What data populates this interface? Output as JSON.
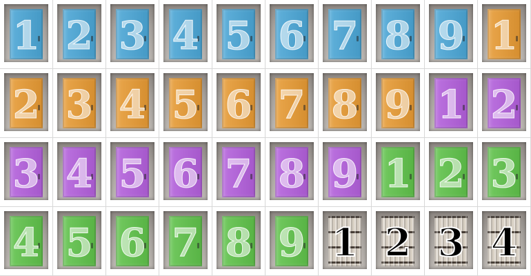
{
  "doors": [
    {
      "number": "1",
      "color": "#4aa6d6"
    },
    {
      "number": "2",
      "color": "#4aa6d6"
    },
    {
      "number": "3",
      "color": "#4aa6d6"
    },
    {
      "number": "4",
      "color": "#4aa6d6"
    },
    {
      "number": "5",
      "color": "#4aa6d6"
    },
    {
      "number": "6",
      "color": "#4aa6d6"
    },
    {
      "number": "7",
      "color": "#4aa6d6"
    },
    {
      "number": "8",
      "color": "#4aa6d6"
    },
    {
      "number": "9",
      "color": "#4aa6d6"
    },
    {
      "number": "1",
      "color": "#e79a33"
    },
    {
      "number": "2",
      "color": "#e79a33"
    },
    {
      "number": "3",
      "color": "#e79a33"
    },
    {
      "number": "4",
      "color": "#e79a33"
    },
    {
      "number": "5",
      "color": "#e79a33"
    },
    {
      "number": "6",
      "color": "#e79a33"
    },
    {
      "number": "7",
      "color": "#e79a33"
    },
    {
      "number": "8",
      "color": "#e79a33"
    },
    {
      "number": "9",
      "color": "#e79a33"
    },
    {
      "number": "1",
      "color": "#b35fdc"
    },
    {
      "number": "2",
      "color": "#b35fdc"
    },
    {
      "number": "3",
      "color": "#b35fdc"
    },
    {
      "number": "4",
      "color": "#b35fdc"
    },
    {
      "number": "5",
      "color": "#b35fdc"
    },
    {
      "number": "6",
      "color": "#b35fdc"
    },
    {
      "number": "7",
      "color": "#b35fdc"
    },
    {
      "number": "8",
      "color": "#b35fdc"
    },
    {
      "number": "9",
      "color": "#b35fdc"
    },
    {
      "number": "1",
      "color": "#5fc24a"
    },
    {
      "number": "2",
      "color": "#5fc24a"
    },
    {
      "number": "3",
      "color": "#5fc24a"
    },
    {
      "number": "4",
      "color": "#5fc24a"
    },
    {
      "number": "5",
      "color": "#5fc24a"
    },
    {
      "number": "6",
      "color": "#5fc24a"
    },
    {
      "number": "7",
      "color": "#5fc24a"
    },
    {
      "number": "8",
      "color": "#5fc24a"
    },
    {
      "number": "9",
      "color": "#5fc24a"
    },
    {
      "number": "1",
      "color": "bookshelf"
    },
    {
      "number": "2",
      "color": "bookshelf"
    },
    {
      "number": "3",
      "color": "bookshelf"
    },
    {
      "number": "4",
      "color": "bookshelf"
    }
  ]
}
